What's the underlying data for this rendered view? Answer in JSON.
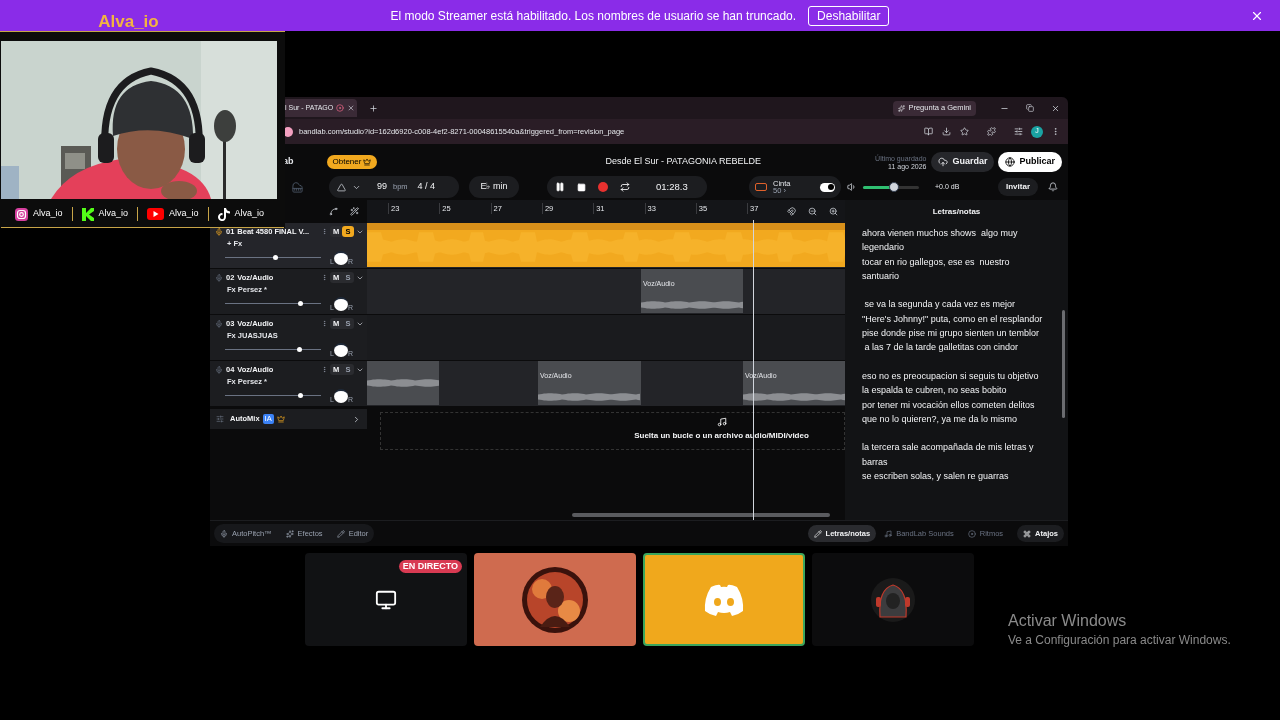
{
  "banner": {
    "message": "El modo Streamer está habilitado. Los nombres de usuario se han truncado.",
    "button": "Deshabilitar"
  },
  "overlay": {
    "title": "Alva_io",
    "socials": [
      {
        "kind": "instagram",
        "handle": "Alva_io"
      },
      {
        "kind": "kick",
        "handle": "Alva_io"
      },
      {
        "kind": "youtube",
        "handle": "Alva_io"
      },
      {
        "kind": "tiktok",
        "handle": "Alva_io"
      }
    ]
  },
  "browser": {
    "tab": {
      "title": "l Sur - PATAGO"
    },
    "gemini_button": "Pregunta a Gemini",
    "url": "bandlab.com/studio?id=162d6920-c008-4ef2-8271-00048615540a&triggered_from=revision_page",
    "profile": "J"
  },
  "studio": {
    "logo": "ab",
    "get_button": "Obtener",
    "project_title": "Desde El Sur - PATAGONIA REBELDE",
    "saved_label": "Último guardado",
    "saved_date": "11 ago 2026",
    "save_button": "Guardar",
    "publish_button": "Publicar",
    "toolbar": {
      "bpm": "99",
      "bpm_unit": "bpm",
      "signature": "4 / 4",
      "key": "E♭ min",
      "time": "01:28.3",
      "tape_label": "Cinta",
      "tape_value": "50 ›",
      "tape_on": true,
      "volume": {
        "level": 0.55
      },
      "gain": "+0.0 dB",
      "invite_button": "Invitar"
    },
    "ruler": [
      "23",
      "25",
      "27",
      "29",
      "31",
      "33",
      "35",
      "37"
    ],
    "tracks": [
      {
        "number": "01",
        "name": "Beat 4580 FINAL V...",
        "fx": "+ Fx",
        "mute_label": "M",
        "solo_label": "S",
        "muted": false,
        "solo": true,
        "pan_left": "L",
        "pan_right": "R",
        "volume": {
          "level": 0.53
        },
        "clips": [
          {
            "kind": "cut"
          }
        ]
      },
      {
        "number": "02",
        "name": "Voz/Audio",
        "fx": "Fx Persez *",
        "mute_label": "M",
        "solo_label": "S",
        "muted": false,
        "solo": false,
        "pan_left": "L",
        "pan_right": "R",
        "volume": {
          "level": 0.79
        },
        "clips": [
          {
            "kind": "clip",
            "label": "Voz/Audio"
          }
        ]
      },
      {
        "number": "03",
        "name": "Voz/Audio",
        "fx": "Fx JUASJUAS",
        "mute_label": "M",
        "solo_label": "S",
        "muted": false,
        "solo": false,
        "pan_left": "L",
        "pan_right": "R",
        "volume": {
          "level": 0.78
        }
      },
      {
        "number": "04",
        "name": "Voz/Audio",
        "fx": "Fx Persez *",
        "mute_label": "M",
        "solo_label": "S",
        "muted": false,
        "solo": false,
        "pan_left": "L",
        "pan_right": "R",
        "volume": {
          "level": 0.79
        },
        "clips": [
          {
            "kind": "cut"
          },
          {
            "kind": "clip",
            "label": "Voz/Audio"
          },
          {
            "kind": "clip",
            "label": "Voz/Audio"
          }
        ]
      }
    ],
    "automix": {
      "label": "AutoMix",
      "badge": "IA"
    },
    "drop_hint": "Suelta un bucle o un archivo audio/MIDI/video",
    "lyrics": {
      "title": "Letras/notas",
      "stanzas": [
        [
          "ahora vienen muchos shows  algo muy legendario",
          "tocar en rio gallegos, ese es  nuestro santuario"
        ],
        [
          " se va la segunda y cada vez es mejor",
          "\"Here's Johnny!\" puta, como en el resplandor",
          "pise donde pise mi grupo sienten un temblor",
          " a las 7 de la tarde galletitas con cindor"
        ],
        [
          "eso no es preocupacion si seguis tu objetivo",
          "la espalda te cubren, no seas bobito",
          "por tener mi vocación ellos cometen delitos",
          "que no lo quieren?, ya me da lo mismo"
        ],
        [
          "la tercera sale acompañada de mis letras y barras",
          "se escriben solas, y salen re guarras"
        ]
      ]
    },
    "bottom_tools": [
      {
        "kind": "autopitch",
        "label": "AutoPitch™"
      },
      {
        "kind": "effects",
        "label": "Efectos"
      },
      {
        "kind": "editor",
        "label": "Editor"
      }
    ],
    "bottom_tabs": [
      {
        "kind": "notes",
        "label": "Letras/notas",
        "selected": true
      },
      {
        "kind": "sounds",
        "label": "BandLab Sounds",
        "selected": false
      },
      {
        "kind": "rhythms",
        "label": "Ritmos",
        "selected": false
      },
      {
        "kind": "shortcuts",
        "label": "Atajos",
        "selected": false
      }
    ]
  },
  "call_tiles": [
    {
      "kind": "screen",
      "badge": "EN DIRECTO",
      "selected": false
    },
    {
      "kind": "avatar",
      "color": "#cf6b4f",
      "selected": false
    },
    {
      "kind": "discord",
      "color": "#f0a81c",
      "selected": true
    },
    {
      "kind": "hooded",
      "selected": false
    }
  ],
  "activation": {
    "title": "Activar Windows",
    "message": "Ve a Configuración para activar Windows."
  }
}
